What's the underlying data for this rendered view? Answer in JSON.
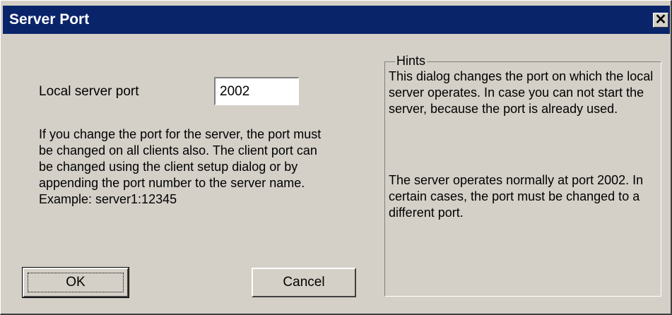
{
  "window": {
    "title": "Server Port",
    "close_glyph": "✕"
  },
  "port": {
    "label": "Local server port",
    "value": "2002"
  },
  "info_text": "If you change the port for the server, the port must be changed on all clients also. The client port can be changed using the client setup dialog or by appending the port number to the server name. Example: server1:12345",
  "buttons": {
    "ok_label": "OK",
    "cancel_label": "Cancel"
  },
  "hints": {
    "legend": "Hints",
    "paragraph1": "This dialog changes the port on which the local server operates. In case you can not start the server, because the port is already used.",
    "paragraph2": "The server operates normally at port 2002. In certain cases, the port must be changed to a different port."
  },
  "colors": {
    "titlebar": "#0a246a",
    "dialog_bg": "#d4d0c8"
  }
}
